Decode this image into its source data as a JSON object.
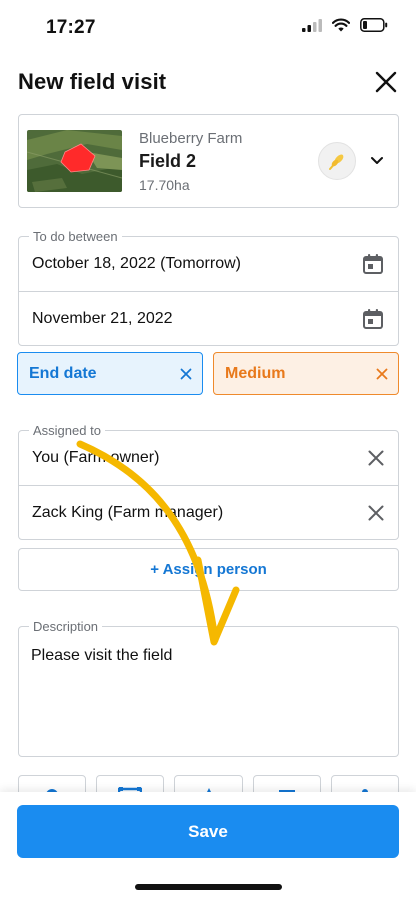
{
  "status": {
    "time": "17:27"
  },
  "header": {
    "title": "New field visit"
  },
  "field": {
    "farm": "Blueberry Farm",
    "name": "Field 2",
    "area": "17.70ha"
  },
  "dates": {
    "label": "To do between",
    "start": "October 18, 2022 (Tomorrow)",
    "end": "November 21, 2022"
  },
  "chips": {
    "end_date": "End date",
    "priority": "Medium"
  },
  "assigned": {
    "label": "Assigned to",
    "people": [
      "You (Farm owner)",
      "Zack King (Farm manager)"
    ],
    "add_label": "+ Assign person"
  },
  "description": {
    "label": "Description",
    "value": "Please visit the field"
  },
  "footer": {
    "save_label": "Save"
  },
  "colors": {
    "accent": "#1a8cf0",
    "chip_blue": "#1477d4",
    "chip_orange": "#e8791b",
    "annotation_arrow": "#f5b800",
    "field_polygon": "#ff2a2a"
  },
  "icons": [
    "signal-icon",
    "wifi-icon",
    "battery-icon",
    "close-icon",
    "crop-icon",
    "chevron-down-icon",
    "calendar-icon",
    "remove-icon"
  ]
}
